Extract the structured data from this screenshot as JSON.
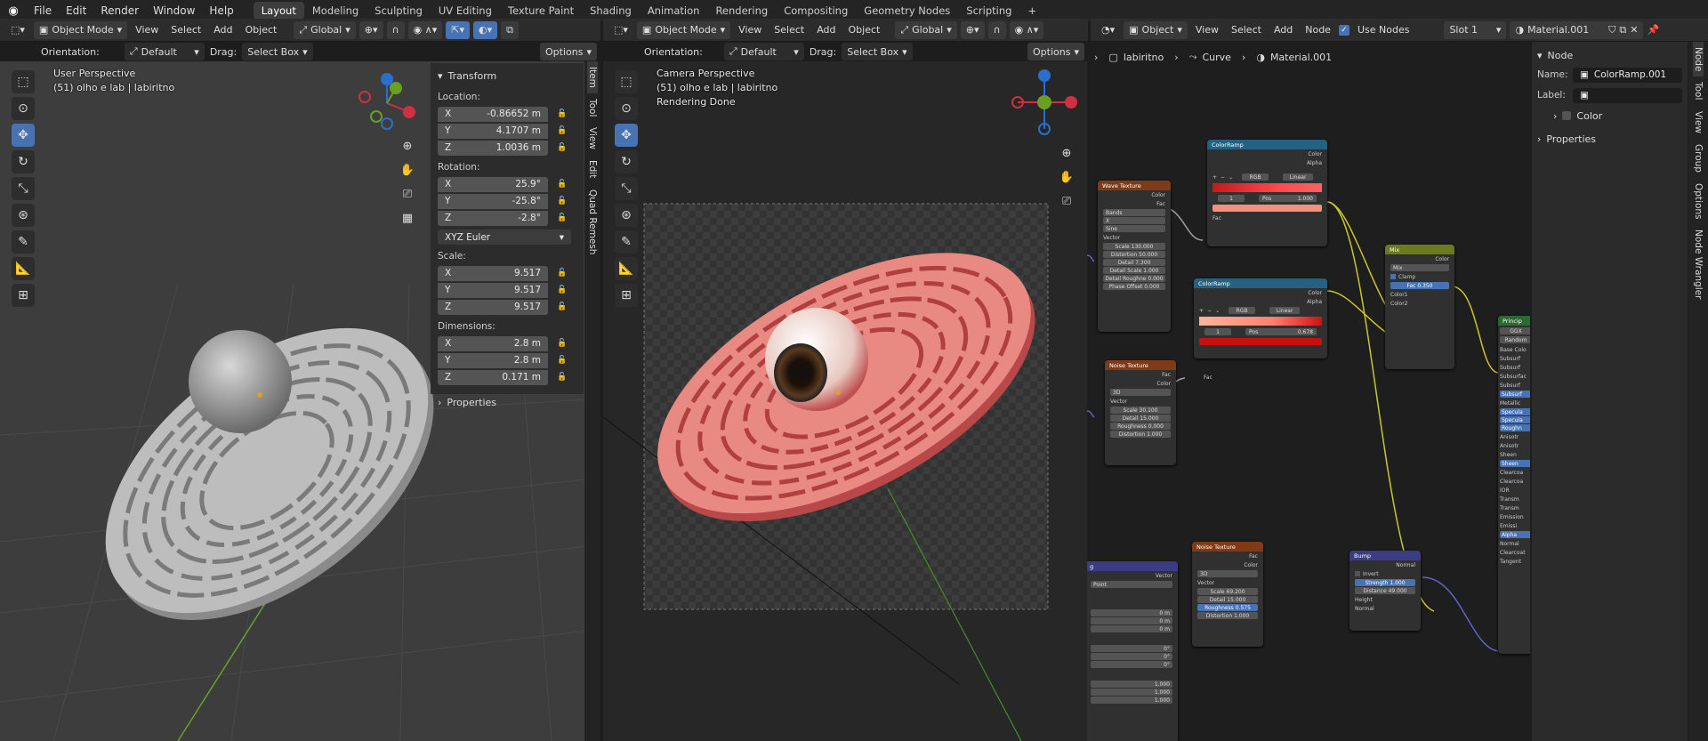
{
  "menu": [
    "File",
    "Edit",
    "Render",
    "Window",
    "Help"
  ],
  "workspaces": [
    "Layout",
    "Modeling",
    "Sculpting",
    "UV Editing",
    "Texture Paint",
    "Shading",
    "Animation",
    "Rendering",
    "Compositing",
    "Geometry Nodes",
    "Scripting"
  ],
  "add_workspace": "+",
  "vp1": {
    "mode": "Object Mode",
    "menus": [
      "View",
      "Select",
      "Add",
      "Object"
    ],
    "transform_orientation": "Global",
    "orientation_label": "Orientation:",
    "orientation_value": "Default",
    "drag_label": "Drag:",
    "drag_value": "Select Box",
    "options": "Options",
    "overlay_title": "User Perspective",
    "overlay_sub": "(51) olho e lab | labiritno"
  },
  "npanel": {
    "transform_title": "Transform",
    "location_label": "Location:",
    "location": [
      {
        "axis": "X",
        "val": "-0.86652 m"
      },
      {
        "axis": "Y",
        "val": "4.1707 m"
      },
      {
        "axis": "Z",
        "val": "1.0036 m"
      }
    ],
    "rotation_label": "Rotation:",
    "rotation": [
      {
        "axis": "X",
        "val": "25.9°"
      },
      {
        "axis": "Y",
        "val": "-25.8°"
      },
      {
        "axis": "Z",
        "val": "-2.8°"
      }
    ],
    "rotation_mode": "XYZ Euler",
    "scale_label": "Scale:",
    "scale": [
      {
        "axis": "X",
        "val": "9.517"
      },
      {
        "axis": "Y",
        "val": "9.517"
      },
      {
        "axis": "Z",
        "val": "9.517"
      }
    ],
    "dimensions_label": "Dimensions:",
    "dimensions": [
      {
        "axis": "X",
        "val": "2.8 m"
      },
      {
        "axis": "Y",
        "val": "2.8 m"
      },
      {
        "axis": "Z",
        "val": "0.171 m"
      }
    ],
    "properties_title": "Properties",
    "tabs": [
      "Item",
      "Tool",
      "View",
      "Edit",
      "Quad Remesh"
    ]
  },
  "vp2": {
    "mode": "Object Mode",
    "menus": [
      "View",
      "Select",
      "Add",
      "Object"
    ],
    "transform_orientation": "Global",
    "orientation_label": "Orientation:",
    "orientation_value": "Default",
    "drag_label": "Drag:",
    "drag_value": "Select Box",
    "options": "Options",
    "overlay_title": "Camera Perspective",
    "overlay_sub": "(51) olho e lab | labiritno",
    "overlay_status": "Rendering Done"
  },
  "node_editor": {
    "type": "Object",
    "menus": [
      "View",
      "Select",
      "Add",
      "Node"
    ],
    "use_nodes_label": "Use Nodes",
    "slot": "Slot 1",
    "material": "Material.001",
    "breadcrumb": [
      "labiritno",
      "Curve",
      "Material.001"
    ],
    "side_tabs": [
      "Node",
      "Tool",
      "View",
      "Group",
      "Options",
      "Node Wrangler"
    ],
    "sidebar": {
      "section": "Node",
      "name_label": "Name:",
      "name_value": "ColorRamp.001",
      "label_label": "Label:",
      "color_label": "Color",
      "properties_label": "Properties"
    },
    "nodes": {
      "colorramp1": {
        "title": "ColorRamp",
        "out_color": "Color",
        "out_alpha": "Alpha",
        "mode": "RGB",
        "interp": "Linear",
        "idx": "1",
        "pos_label": "Pos",
        "pos": "1.000",
        "in_fac": "Fac"
      },
      "wave": {
        "title": "Wave Texture",
        "out_color": "Color",
        "out_fac": "Fac",
        "type": "Bands",
        "dir": "X",
        "profile": "Sine",
        "vector": "Vector",
        "scale": "Scale",
        "scale_v": "130.000",
        "distortion": "Distortion",
        "distortion_v": "50.000",
        "detail": "Detail",
        "detail_v": "7.300",
        "detail_scale": "Detail Scale",
        "detail_scale_v": "1.000",
        "detail_rough": "Detail Roughne",
        "detail_rough_v": "0.000",
        "phase": "Phase Offset",
        "phase_v": "0.000"
      },
      "colorramp2": {
        "title": "ColorRamp",
        "out_color": "Color",
        "out_alpha": "Alpha",
        "mode": "RGB",
        "interp": "Linear",
        "idx": "1",
        "pos_label": "Pos",
        "pos": "0.678",
        "in_fac": "Fac"
      },
      "noise1": {
        "title": "Noise Texture",
        "out_fac": "Fac",
        "out_color": "Color",
        "dim": "3D",
        "vector": "Vector",
        "scale": "Scale",
        "scale_v": "30.100",
        "detail": "Detail",
        "detail_v": "15.000",
        "rough": "Roughness",
        "rough_v": "0.000",
        "dist": "Distortion",
        "dist_v": "1.000"
      },
      "mix": {
        "title": "Mix",
        "out_color": "Color",
        "mode": "Mix",
        "clamp": "Clamp",
        "fac": "Fac",
        "fac_v": "0.350",
        "c1": "Color1",
        "c2": "Color2"
      },
      "principled": {
        "title": "Princip",
        "dist": "GGX",
        "ss": "Random",
        "inputs": [
          "Base Colo",
          "Subsurf",
          "Subsurf",
          "Subsurfac",
          "Subsurf",
          "Subsurf",
          "Metallic",
          "Specula",
          "Specula",
          "Roughn",
          "Anisotr",
          "Anisotr",
          "Sheen",
          "Sheen",
          "Clearcoa",
          "Clearcoa",
          "IOR",
          "Transm",
          "Transm",
          "Emission",
          "Emissi",
          "Alpha",
          "Normal",
          "Clearcoat",
          "Tangent"
        ]
      },
      "noise2": {
        "title": "Noise Texture",
        "out_fac": "Fac",
        "out_color": "Color",
        "dim": "3D",
        "vector": "Vector",
        "scale": "Scale",
        "scale_v": "69.200",
        "detail": "Detail",
        "detail_v": "15.000",
        "rough": "Roughness",
        "rough_v": "0.575",
        "dist": "Distortion",
        "dist_v": "1.000"
      },
      "bump": {
        "title": "Bump",
        "out_normal": "Normal",
        "invert": "Invert",
        "strength": "Strength",
        "strength_v": "1.000",
        "distance": "Distance",
        "distance_v": "49.000",
        "height": "Height",
        "normal": "Normal"
      },
      "mapping": {
        "title": "g",
        "out_vector": "Vector",
        "type": "Point",
        "loc": [
          "0 m",
          "0 m",
          "0 m"
        ],
        "rot": [
          "0°",
          "0°",
          "0°"
        ],
        "scl": [
          "1.000",
          "1.000",
          "1.000"
        ]
      }
    }
  },
  "colors": {
    "accent": "#4772b3",
    "wave_header": "#7d3c17",
    "ramp_header": "#246283",
    "mix_header": "#6b7a1e",
    "shader_header": "#2a6b34",
    "vector_header": "#3c3c83"
  }
}
